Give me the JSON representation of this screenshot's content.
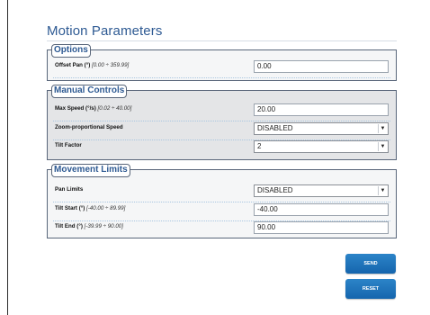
{
  "page": {
    "title": "Motion Parameters"
  },
  "sections": {
    "options": {
      "legend": "Options",
      "offset_pan": {
        "label": "Offset Pan (°)",
        "range": "[0.00 ÷ 359.99]",
        "value": "0.00"
      }
    },
    "manual_controls": {
      "legend": "Manual Controls",
      "max_speed": {
        "label": "Max Speed (°/s)",
        "range": "[0.02 ÷ 40.00]",
        "value": "20.00"
      },
      "zoom_speed": {
        "label": "Zoom-proportional Speed",
        "value": "DISABLED"
      },
      "tilt_factor": {
        "label": "Tilt Factor",
        "value": "2"
      }
    },
    "movement_limits": {
      "legend": "Movement Limits",
      "pan_limits": {
        "label": "Pan Limits",
        "value": "DISABLED"
      },
      "tilt_start": {
        "label": "Tilt Start (°)",
        "range": "[-40.00 ÷ 89.99]",
        "value": "-40.00"
      },
      "tilt_end": {
        "label": "Tilt End (°)",
        "range": "[-39.99 ÷ 90.00]",
        "value": "90.00"
      }
    }
  },
  "buttons": {
    "send": "SEND",
    "reset": "RESET"
  },
  "icons": {
    "dropdown": "chevron-down-icon"
  },
  "colors": {
    "title": "#2e5a93",
    "button": "#1b6fb8",
    "section_border": "#59667a"
  }
}
